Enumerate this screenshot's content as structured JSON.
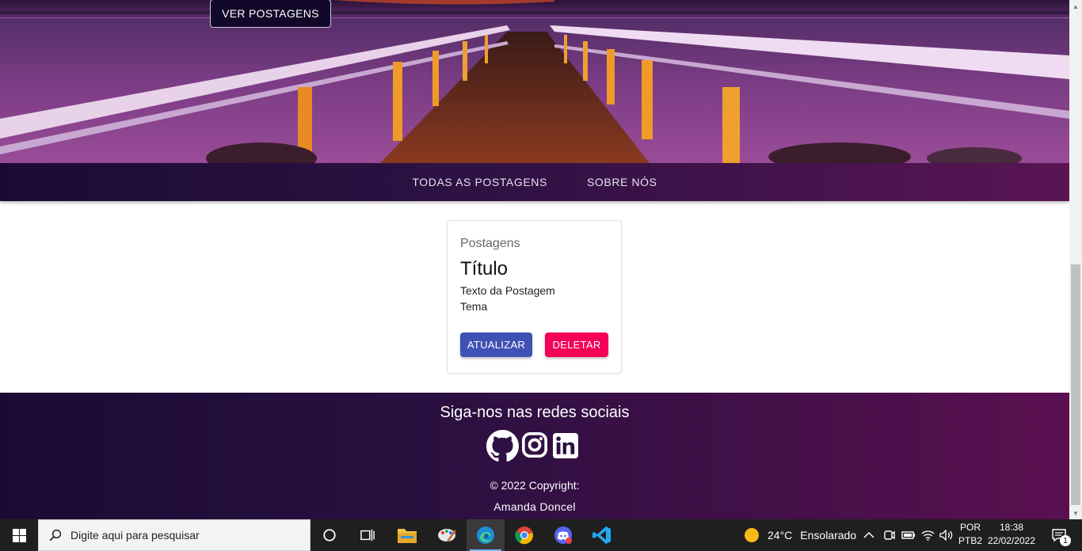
{
  "hero": {
    "button_label": "VER POSTAGENS"
  },
  "nav": {
    "items": [
      {
        "label": "TODAS AS POSTAGENS"
      },
      {
        "label": "SOBRE NÓS"
      }
    ]
  },
  "post": {
    "category": "Postagens",
    "title": "Título",
    "text": "Texto da Postagem",
    "tema": "Tema",
    "update_label": "ATUALIZAR",
    "delete_label": "DELETAR",
    "update_color": "#3f51b5",
    "delete_color": "#f50057"
  },
  "footer": {
    "title": "Siga-nos nas redes sociais",
    "social": [
      {
        "icon": "github-icon"
      },
      {
        "icon": "instagram-icon"
      },
      {
        "icon": "linkedin-icon"
      }
    ],
    "copyright": "© 2022 Copyright:",
    "author": "Amanda Doncel"
  },
  "taskbar": {
    "search_placeholder": "Digite aqui para pesquisar",
    "weather": {
      "temp": "24°C",
      "condition": "Ensolarado"
    },
    "lang": {
      "line1": "POR",
      "line2": "PTB2"
    },
    "clock": {
      "time": "18:38",
      "date": "22/02/2022"
    },
    "notification_count": "1",
    "apps": [
      {
        "icon": "cortana-icon"
      },
      {
        "icon": "task-view-icon"
      },
      {
        "icon": "file-explorer-icon"
      },
      {
        "icon": "paint-icon"
      },
      {
        "icon": "edge-icon"
      },
      {
        "icon": "chrome-icon"
      },
      {
        "icon": "discord-icon"
      },
      {
        "icon": "vscode-icon"
      }
    ]
  }
}
